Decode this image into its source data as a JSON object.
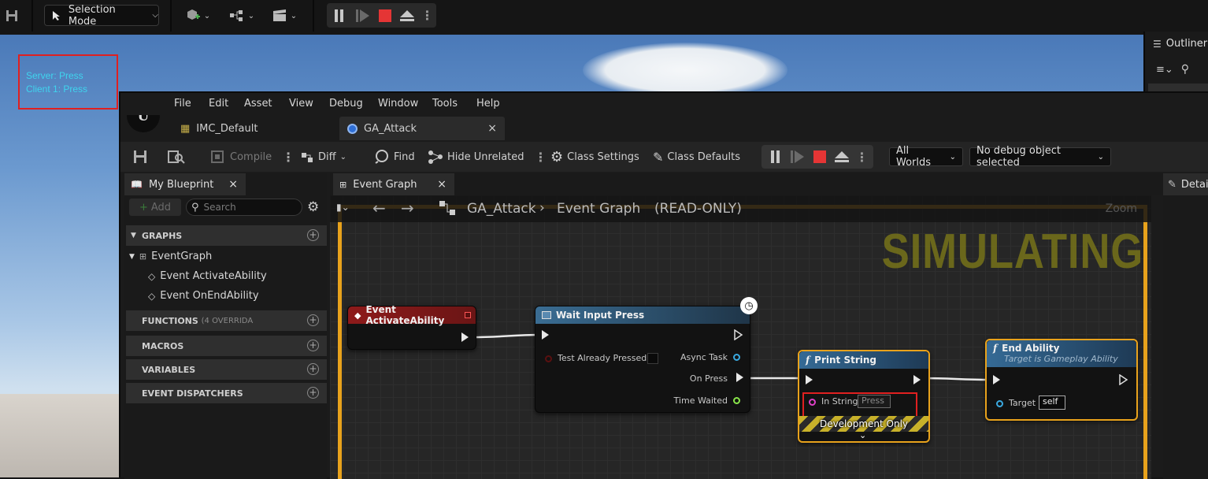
{
  "top_toolbar": {
    "selection_mode": "Selection Mode"
  },
  "viewport": {
    "debug_lines": [
      "Server: Press",
      "Client 1: Press"
    ]
  },
  "outliner": {
    "title": "Outliner"
  },
  "blueprint": {
    "menu": [
      "File",
      "Edit",
      "Asset",
      "View",
      "Debug",
      "Window",
      "Tools",
      "Help"
    ],
    "tabs": [
      {
        "label": "IMC_Default"
      },
      {
        "label": "GA_Attack"
      }
    ],
    "toolbar": {
      "compile": "Compile",
      "diff": "Diff",
      "find": "Find",
      "hide_unrelated": "Hide Unrelated",
      "class_settings": "Class Settings",
      "class_defaults": "Class Defaults",
      "world_dropdown": "All Worlds",
      "debug_object_dropdown": "No debug object selected"
    },
    "my_blueprint": {
      "tab": "My Blueprint",
      "add": "Add",
      "search_placeholder": "Search",
      "sections": {
        "graphs": "GRAPHS",
        "functions": "FUNCTIONS",
        "functions_note": "(4 OVERRIDA",
        "macros": "MACROS",
        "variables": "VARIABLES",
        "dispatchers": "EVENT DISPATCHERS"
      },
      "graph_items": {
        "event_graph": "EventGraph",
        "activate": "Event ActivateAbility",
        "end": "Event OnEndAbility"
      }
    },
    "graph": {
      "tab": "Event Graph",
      "breadcrumb_root": "GA_Attack",
      "breadcrumb_graph": "Event Graph",
      "readonly": "(READ-ONLY)",
      "zoom": "Zoom",
      "watermark": "SIMULATING",
      "nodes": {
        "event_activate": {
          "title": "Event ActivateAbility"
        },
        "wait_input": {
          "title": "Wait Input Press",
          "test_already": "Test Already Pressed",
          "async_task": "Async Task",
          "on_press": "On Press",
          "time_waited": "Time Waited"
        },
        "print_string": {
          "title": "Print String",
          "in_string": "In String",
          "in_string_value": "Press",
          "dev_only": "Development Only"
        },
        "end_ability": {
          "title": "End Ability",
          "subtitle": "Target is Gameplay Ability",
          "target": "Target",
          "target_value": "self"
        }
      }
    },
    "details": {
      "title": "Detail"
    }
  }
}
